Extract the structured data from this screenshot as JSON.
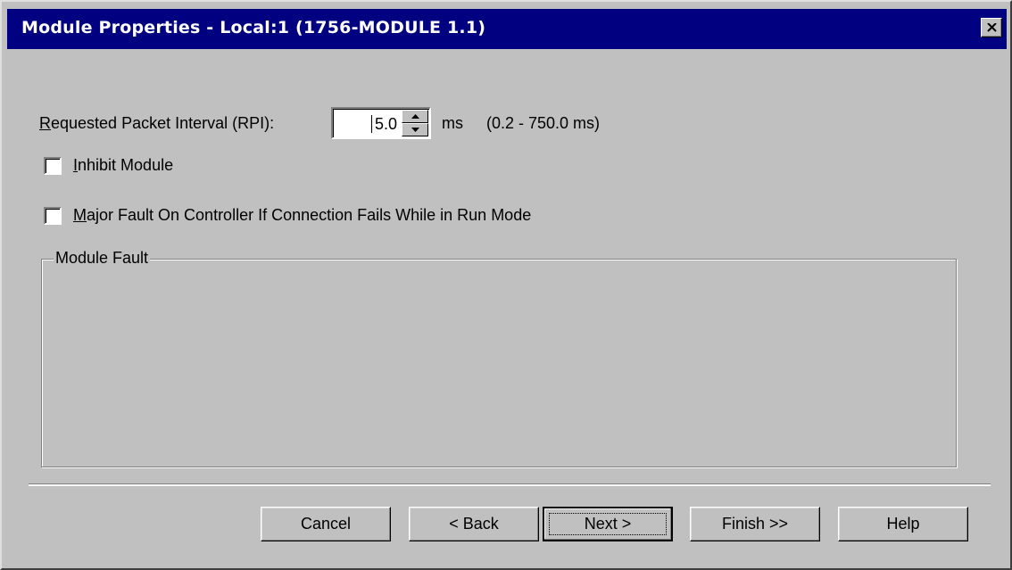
{
  "window": {
    "title": "Module Properties - Local:1 (1756-MODULE 1.1)"
  },
  "rpi": {
    "label_ul": "R",
    "label_rest": "equested Packet Interval (RPI):",
    "value": "5.0",
    "unit": "ms",
    "range": "(0.2 - 750.0 ms)"
  },
  "inhibit": {
    "label_ul": "I",
    "label_rest": "nhibit Module",
    "checked": false
  },
  "major_fault": {
    "label_ul": "M",
    "label_rest": "ajor Fault On Controller If Connection Fails While in Run Mode",
    "checked": false
  },
  "module_fault": {
    "label": "Module Fault"
  },
  "buttons": {
    "cancel": "Cancel",
    "back": "< Back",
    "next": "Next >",
    "finish": "Finish >>",
    "help": "Help"
  },
  "icons": {
    "close": "close-icon",
    "spin_up": "arrow-up-icon",
    "spin_down": "arrow-down-icon"
  }
}
